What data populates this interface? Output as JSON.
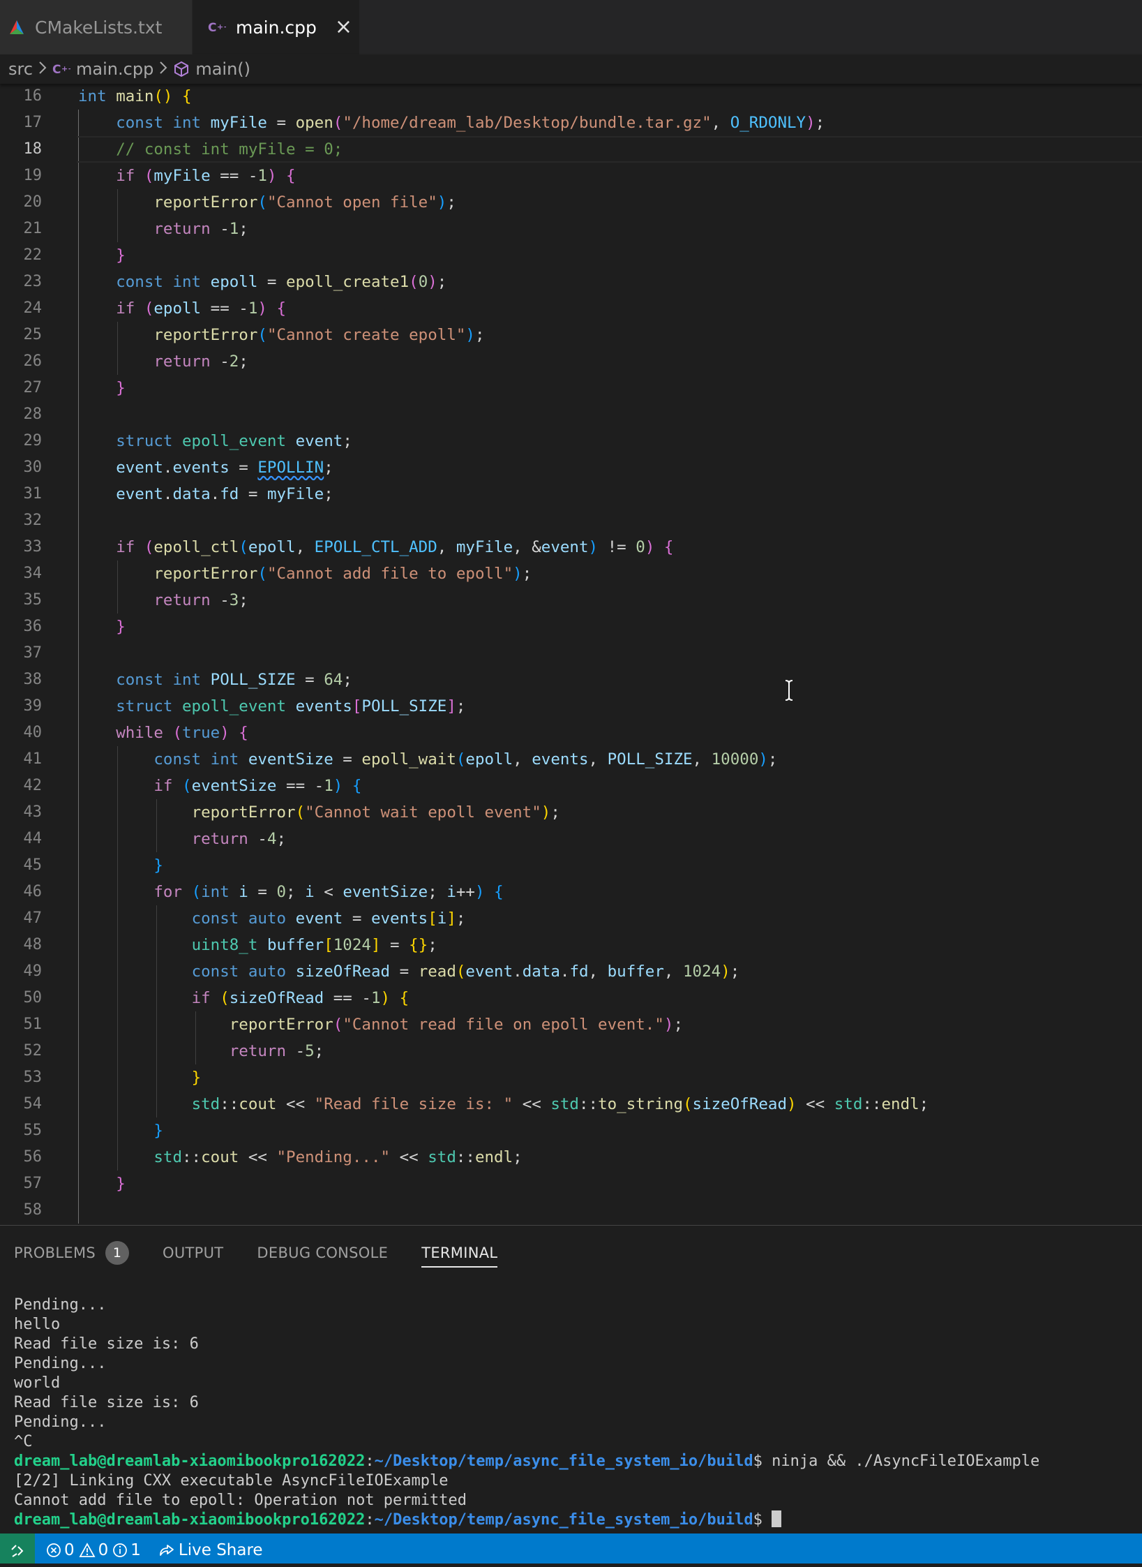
{
  "tabs": [
    {
      "label": "CMakeLists.txt",
      "icon": "cmake-icon",
      "active": false
    },
    {
      "label": "main.cpp",
      "icon": "cpp-file-icon",
      "active": true,
      "close": "×"
    }
  ],
  "breadcrumb": {
    "folder": "src",
    "file": "main.cpp",
    "symbol": "main()",
    "separator": ">"
  },
  "editor": {
    "current_line": 18,
    "lines": [
      {
        "n": "16",
        "text": "int main() {"
      },
      {
        "n": "17",
        "text": "    const int myFile = open(\"/home/dream_lab/Desktop/bundle.tar.gz\", O_RDONLY);"
      },
      {
        "n": "18",
        "text": "    // const int myFile = 0;"
      },
      {
        "n": "19",
        "text": "    if (myFile == -1) {"
      },
      {
        "n": "20",
        "text": "        reportError(\"Cannot open file\");"
      },
      {
        "n": "21",
        "text": "        return -1;"
      },
      {
        "n": "22",
        "text": "    }"
      },
      {
        "n": "23",
        "text": "    const int epoll = epoll_create1(0);"
      },
      {
        "n": "24",
        "text": "    if (epoll == -1) {"
      },
      {
        "n": "25",
        "text": "        reportError(\"Cannot create epoll\");"
      },
      {
        "n": "26",
        "text": "        return -2;"
      },
      {
        "n": "27",
        "text": "    }"
      },
      {
        "n": "28",
        "text": ""
      },
      {
        "n": "29",
        "text": "    struct epoll_event event;"
      },
      {
        "n": "30",
        "text": "    event.events = EPOLLIN;"
      },
      {
        "n": "31",
        "text": "    event.data.fd = myFile;"
      },
      {
        "n": "32",
        "text": ""
      },
      {
        "n": "33",
        "text": "    if (epoll_ctl(epoll, EPOLL_CTL_ADD, myFile, &event) != 0) {"
      },
      {
        "n": "34",
        "text": "        reportError(\"Cannot add file to epoll\");"
      },
      {
        "n": "35",
        "text": "        return -3;"
      },
      {
        "n": "36",
        "text": "    }"
      },
      {
        "n": "37",
        "text": ""
      },
      {
        "n": "38",
        "text": "    const int POLL_SIZE = 64;"
      },
      {
        "n": "39",
        "text": "    struct epoll_event events[POLL_SIZE];"
      },
      {
        "n": "40",
        "text": "    while (true) {"
      },
      {
        "n": "41",
        "text": "        const int eventSize = epoll_wait(epoll, events, POLL_SIZE, 10000);"
      },
      {
        "n": "42",
        "text": "        if (eventSize == -1) {"
      },
      {
        "n": "43",
        "text": "            reportError(\"Cannot wait epoll event\");"
      },
      {
        "n": "44",
        "text": "            return -4;"
      },
      {
        "n": "45",
        "text": "        }"
      },
      {
        "n": "46",
        "text": "        for (int i = 0; i < eventSize; i++) {"
      },
      {
        "n": "47",
        "text": "            const auto event = events[i];"
      },
      {
        "n": "48",
        "text": "            uint8_t buffer[1024] = {};"
      },
      {
        "n": "49",
        "text": "            const auto sizeOfRead = read(event.data.fd, buffer, 1024);"
      },
      {
        "n": "50",
        "text": "            if (sizeOfRead == -1) {"
      },
      {
        "n": "51",
        "text": "                reportError(\"Cannot read file on epoll event.\");"
      },
      {
        "n": "52",
        "text": "                return -5;"
      },
      {
        "n": "53",
        "text": "            }"
      },
      {
        "n": "54",
        "text": "            std::cout << \"Read file size is: \" << std::to_string(sizeOfRead) << std::endl;"
      },
      {
        "n": "55",
        "text": "        }"
      },
      {
        "n": "56",
        "text": "        std::cout << \"Pending...\" << std::endl;"
      },
      {
        "n": "57",
        "text": "    }"
      },
      {
        "n": "58",
        "text": ""
      }
    ]
  },
  "panel": {
    "tabs": [
      {
        "label": "PROBLEMS",
        "badge": "1",
        "active": false
      },
      {
        "label": "OUTPUT",
        "active": false
      },
      {
        "label": "DEBUG CONSOLE",
        "active": false
      },
      {
        "label": "TERMINAL",
        "active": true
      }
    ],
    "terminal": {
      "output": [
        "Pending...",
        "hello",
        "Read file size is: 6",
        "Pending...",
        "world",
        "Read file size is: 6",
        "Pending...",
        "^C"
      ],
      "prompt_user": "dream_lab@dreamlab-xiaomibookpro162022",
      "prompt_path": "~/Desktop/temp/async_file_system_io/build",
      "prompt_symbol": "$",
      "command": " ninja && ./AsyncFileIOExample",
      "result": [
        "[2/2] Linking CXX executable AsyncFileIOExample",
        "Cannot add file to epoll: Operation not permitted"
      ]
    }
  },
  "statusbar": {
    "errors": "0",
    "warnings": "0",
    "infos": "1",
    "live_share": "Live Share",
    "colors": {
      "background": "#007acc",
      "remote": "#16825d"
    }
  }
}
